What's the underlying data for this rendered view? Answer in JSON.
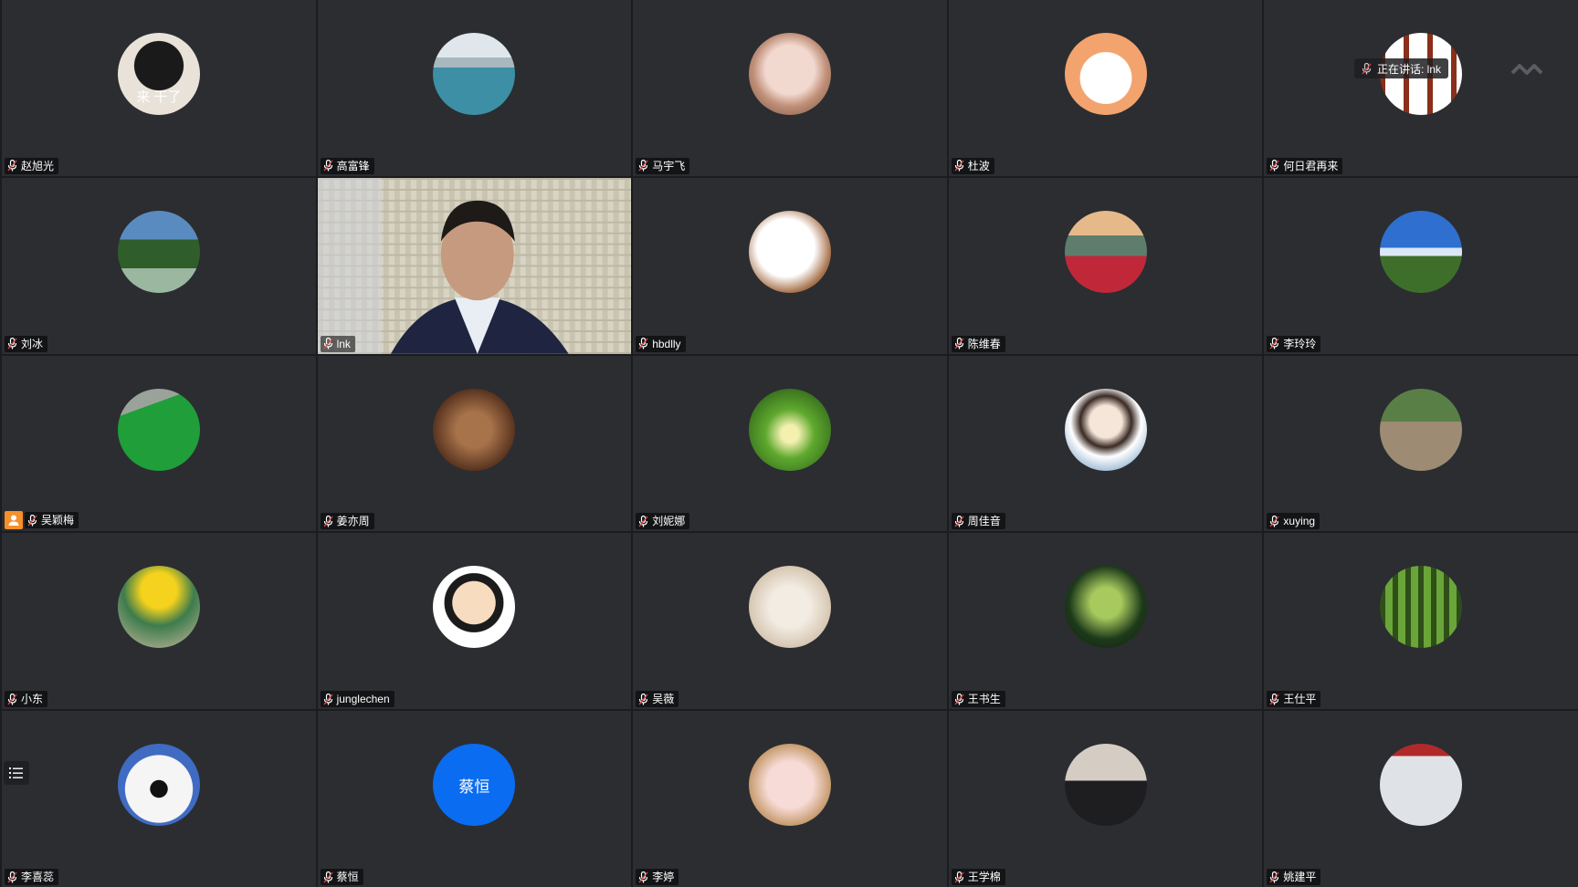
{
  "speaking": {
    "label": "正在讲话: lnk"
  },
  "participants": [
    {
      "name": "赵旭光",
      "avatar": "mascot-bear",
      "caption": "来 干了"
    },
    {
      "name": "高富锋",
      "avatar": "lake"
    },
    {
      "name": "马宇飞",
      "avatar": "cat"
    },
    {
      "name": "杜波",
      "avatar": "cartoon-bunny"
    },
    {
      "name": "何日君再来",
      "avatar": "window"
    },
    {
      "name": "刘冰",
      "avatar": "park"
    },
    {
      "name": "lnk",
      "avatar": "video",
      "video": true
    },
    {
      "name": "hbdlly",
      "avatar": "sketch-girl"
    },
    {
      "name": "陈维春",
      "avatar": "flowers-mountain"
    },
    {
      "name": "李玲玲",
      "avatar": "blue-sky"
    },
    {
      "name": "吴颖梅",
      "avatar": "green-leaves",
      "host": true
    },
    {
      "name": "姜亦周",
      "avatar": "library"
    },
    {
      "name": "刘妮娜",
      "avatar": "sunlit-forest"
    },
    {
      "name": "周佳音",
      "avatar": "illustrated-girl"
    },
    {
      "name": "xuying",
      "avatar": "walking-woman"
    },
    {
      "name": "小东",
      "avatar": "daffodils"
    },
    {
      "name": "junglechen",
      "avatar": "cartoon-boy"
    },
    {
      "name": "吴薇",
      "avatar": "dancer"
    },
    {
      "name": "王书生",
      "avatar": "tea-glass"
    },
    {
      "name": "王仕平",
      "avatar": "tall-forest"
    },
    {
      "name": "李喜蕊",
      "avatar": "cool-bear"
    },
    {
      "name": "蔡恒",
      "avatar": "initials",
      "initials": "蔡恒"
    },
    {
      "name": "李婷",
      "avatar": "piglet"
    },
    {
      "name": "王学棉",
      "avatar": "man-suit"
    },
    {
      "name": "姚建平",
      "avatar": "building-door"
    }
  ],
  "colors": {
    "tile_bg": "#2b2d31",
    "active_border": "#3fbf6a",
    "host_badge": "#f6902a",
    "initials_avatar": "#0a6cf0"
  },
  "icons": {
    "mic": "mic-muted-icon",
    "list": "list-icon",
    "signal": "signal-icon",
    "host": "host-icon"
  }
}
